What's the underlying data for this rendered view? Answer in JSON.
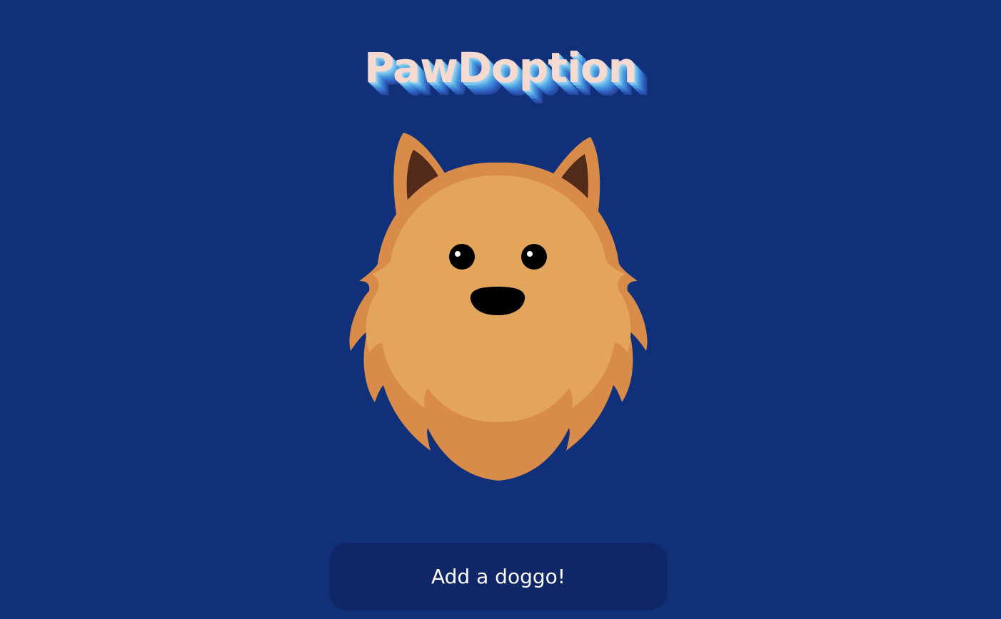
{
  "header": {
    "title": "PawDoption"
  },
  "hero": {
    "illustration": "pomeranian-dog-face",
    "colors": {
      "background": "#11307a",
      "fur_outer": "#d98b4a",
      "fur_inner": "#e3a55b",
      "ear_inner": "#512a19",
      "eye": "#000000",
      "nose": "#000000"
    }
  },
  "actions": {
    "add_label": "Add a doggo!"
  },
  "theme": {
    "button_bg": "#0f2766",
    "title_color": "#f6d9cf",
    "title_shadow": "#4897dd"
  }
}
